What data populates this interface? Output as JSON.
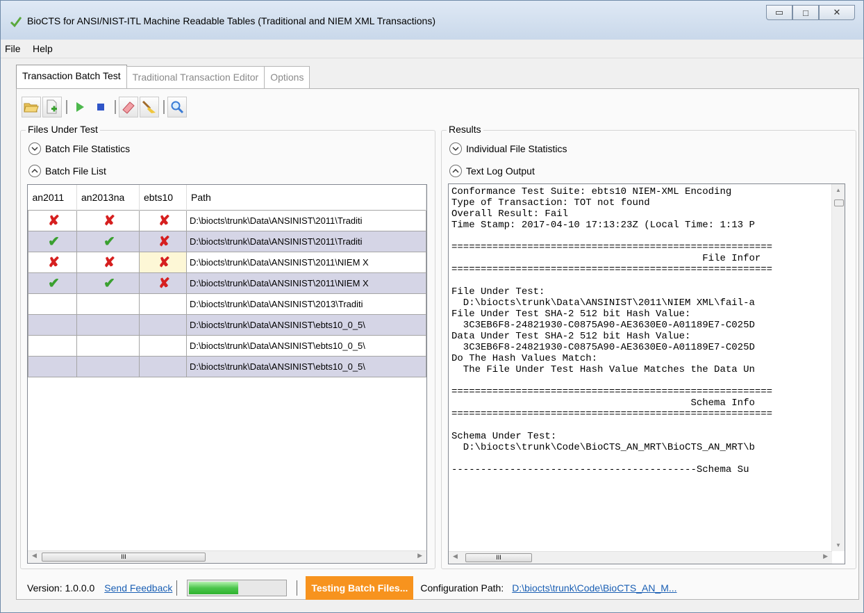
{
  "window": {
    "title": "BioCTS for ANSI/NIST-ITL Machine Readable Tables (Traditional and NIEM XML Transactions)",
    "minimize_glyph": "▭",
    "maximize_glyph": "□",
    "close_glyph": "✕"
  },
  "menu": {
    "items": [
      "File",
      "Help"
    ]
  },
  "tabs": [
    "Transaction Batch Test",
    "Traditional Transaction Editor",
    "Options"
  ],
  "toolbar": {
    "icons": [
      "open-folder-icon",
      "add-file-icon",
      "run-icon",
      "stop-icon",
      "eraser-icon",
      "broom-icon",
      "magnifier-icon"
    ]
  },
  "files_under_test": {
    "label": "Files Under Test",
    "stats_expander": "Batch File Statistics",
    "list_expander": "Batch File List",
    "columns": [
      "an2011",
      "an2013na",
      "ebts10",
      "Path"
    ],
    "rows": [
      {
        "an2011": "fail",
        "an2013na": "fail",
        "ebts10": "fail",
        "path": "D:\\biocts\\trunk\\Data\\ANSINIST\\2011\\Traditi"
      },
      {
        "an2011": "pass",
        "an2013na": "pass",
        "ebts10": "fail",
        "path": "D:\\biocts\\trunk\\Data\\ANSINIST\\2011\\Traditi"
      },
      {
        "an2011": "fail",
        "an2013na": "fail",
        "ebts10": "fail",
        "path": "D:\\biocts\\trunk\\Data\\ANSINIST\\2011\\NIEM X"
      },
      {
        "an2011": "pass",
        "an2013na": "pass",
        "ebts10": "fail",
        "path": "D:\\biocts\\trunk\\Data\\ANSINIST\\2011\\NIEM X"
      },
      {
        "an2011": "",
        "an2013na": "",
        "ebts10": "",
        "path": "D:\\biocts\\trunk\\Data\\ANSINIST\\2013\\Traditi"
      },
      {
        "an2011": "",
        "an2013na": "",
        "ebts10": "",
        "path": "D:\\biocts\\trunk\\Data\\ANSINIST\\ebts10_0_5\\"
      },
      {
        "an2011": "",
        "an2013na": "",
        "ebts10": "",
        "path": "D:\\biocts\\trunk\\Data\\ANSINIST\\ebts10_0_5\\"
      },
      {
        "an2011": "",
        "an2013na": "",
        "ebts10": "",
        "path": "D:\\biocts\\trunk\\Data\\ANSINIST\\ebts10_0_5\\"
      }
    ],
    "scroll_glyph": "III"
  },
  "results": {
    "label": "Results",
    "stats_expander": "Individual File Statistics",
    "log_expander": "Text Log Output",
    "log_text": "Conformance Test Suite: ebts10 NIEM-XML Encoding\nType of Transaction: TOT not found\nOverall Result: Fail\nTime Stamp: 2017-04-10 17:13:23Z (Local Time: 1:13 P\n\n=======================================================\n                                           File Infor\n=======================================================\n\nFile Under Test:\n  D:\\biocts\\trunk\\Data\\ANSINIST\\2011\\NIEM XML\\fail-a\nFile Under Test SHA-2 512 bit Hash Value:\n  3C3EB6F8-24821930-C0875A90-AE3630E0-A01189E7-C025D\nData Under Test SHA-2 512 bit Hash Value:\n  3C3EB6F8-24821930-C0875A90-AE3630E0-A01189E7-C025D\nDo The Hash Values Match:\n  The File Under Test Hash Value Matches the Data Un\n\n=======================================================\n                                         Schema Info\n=======================================================\n\nSchema Under Test:\n  D:\\biocts\\trunk\\Code\\BioCTS_AN_MRT\\BioCTS_AN_MRT\\b\n\n------------------------------------------Schema Su"
  },
  "status": {
    "version": "Version: 1.0.0.0",
    "feedback_link": "Send Feedback",
    "progress": 0.5,
    "badge": "Testing Batch Files...",
    "config_label": "Configuration Path:",
    "config_path": "D:\\biocts\\trunk\\Code\\BioCTS_AN_M..."
  },
  "colors": {
    "accent": "#f7931e",
    "link": "#1a5fb4",
    "fail": "#d61f1f",
    "pass": "#3aa030",
    "row_alt": "#d5d5e6"
  }
}
